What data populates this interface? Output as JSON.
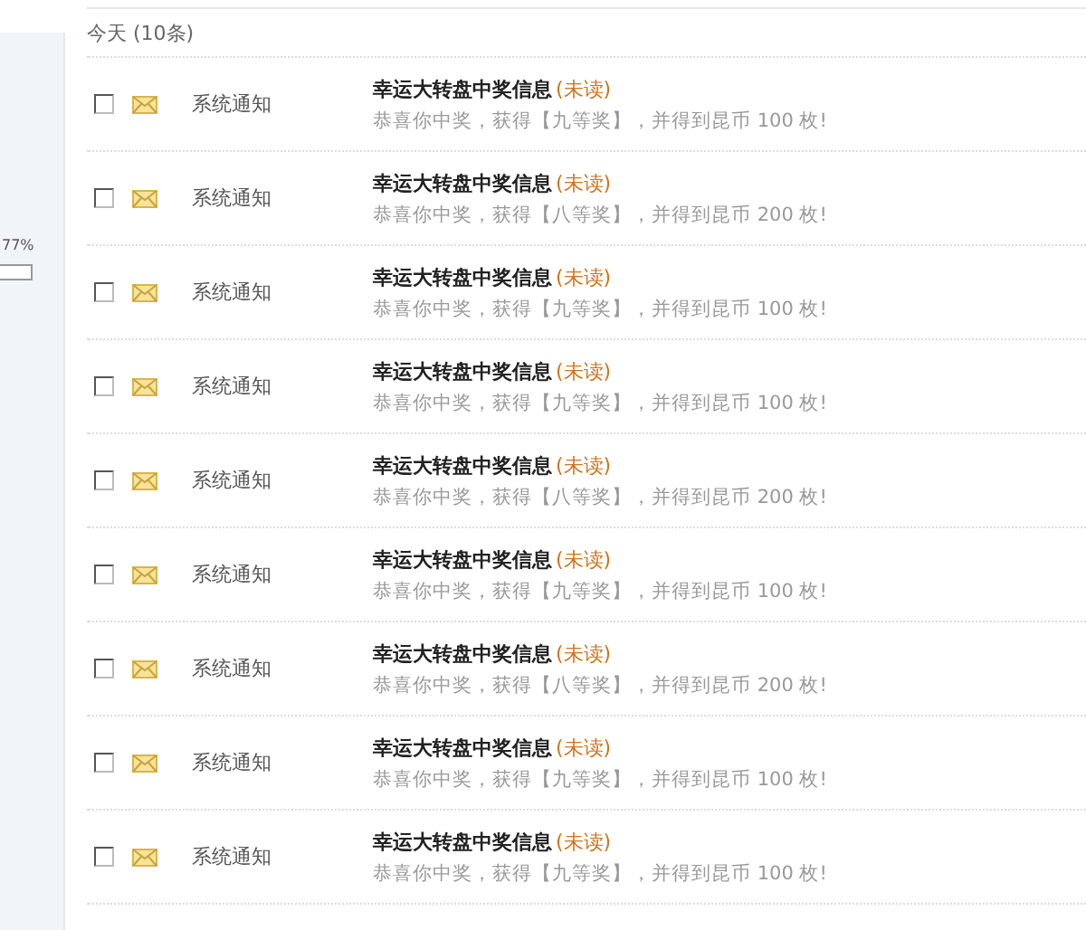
{
  "sidebar": {
    "usage": {
      "reading": "77%"
    }
  },
  "section": {
    "title": "今天 (10条)"
  },
  "messages": [
    {
      "checked": false,
      "sender": "系统通知",
      "title": "幸运大转盘中奖信息",
      "status": "(未读)",
      "body": "恭喜你中奖，获得【九等奖】，并得到昆币 100 枚!"
    },
    {
      "checked": false,
      "sender": "系统通知",
      "title": "幸运大转盘中奖信息",
      "status": "(未读)",
      "body": "恭喜你中奖，获得【八等奖】，并得到昆币 200 枚!"
    },
    {
      "checked": false,
      "sender": "系统通知",
      "title": "幸运大转盘中奖信息",
      "status": "(未读)",
      "body": "恭喜你中奖，获得【九等奖】，并得到昆币 100 枚!"
    },
    {
      "checked": false,
      "sender": "系统通知",
      "title": "幸运大转盘中奖信息",
      "status": "(未读)",
      "body": "恭喜你中奖，获得【九等奖】，并得到昆币 100 枚!"
    },
    {
      "checked": false,
      "sender": "系统通知",
      "title": "幸运大转盘中奖信息",
      "status": "(未读)",
      "body": "恭喜你中奖，获得【八等奖】，并得到昆币 200 枚!"
    },
    {
      "checked": false,
      "sender": "系统通知",
      "title": "幸运大转盘中奖信息",
      "status": "(未读)",
      "body": "恭喜你中奖，获得【九等奖】，并得到昆币 100 枚!"
    },
    {
      "checked": false,
      "sender": "系统通知",
      "title": "幸运大转盘中奖信息",
      "status": "(未读)",
      "body": "恭喜你中奖，获得【八等奖】，并得到昆币 200 枚!"
    },
    {
      "checked": false,
      "sender": "系统通知",
      "title": "幸运大转盘中奖信息",
      "status": "(未读)",
      "body": "恭喜你中奖，获得【九等奖】，并得到昆币 100 枚!"
    },
    {
      "checked": false,
      "sender": "系统通知",
      "title": "幸运大转盘中奖信息",
      "status": "(未读)",
      "body": "恭喜你中奖，获得【九等奖】，并得到昆币 100 枚!"
    }
  ]
}
